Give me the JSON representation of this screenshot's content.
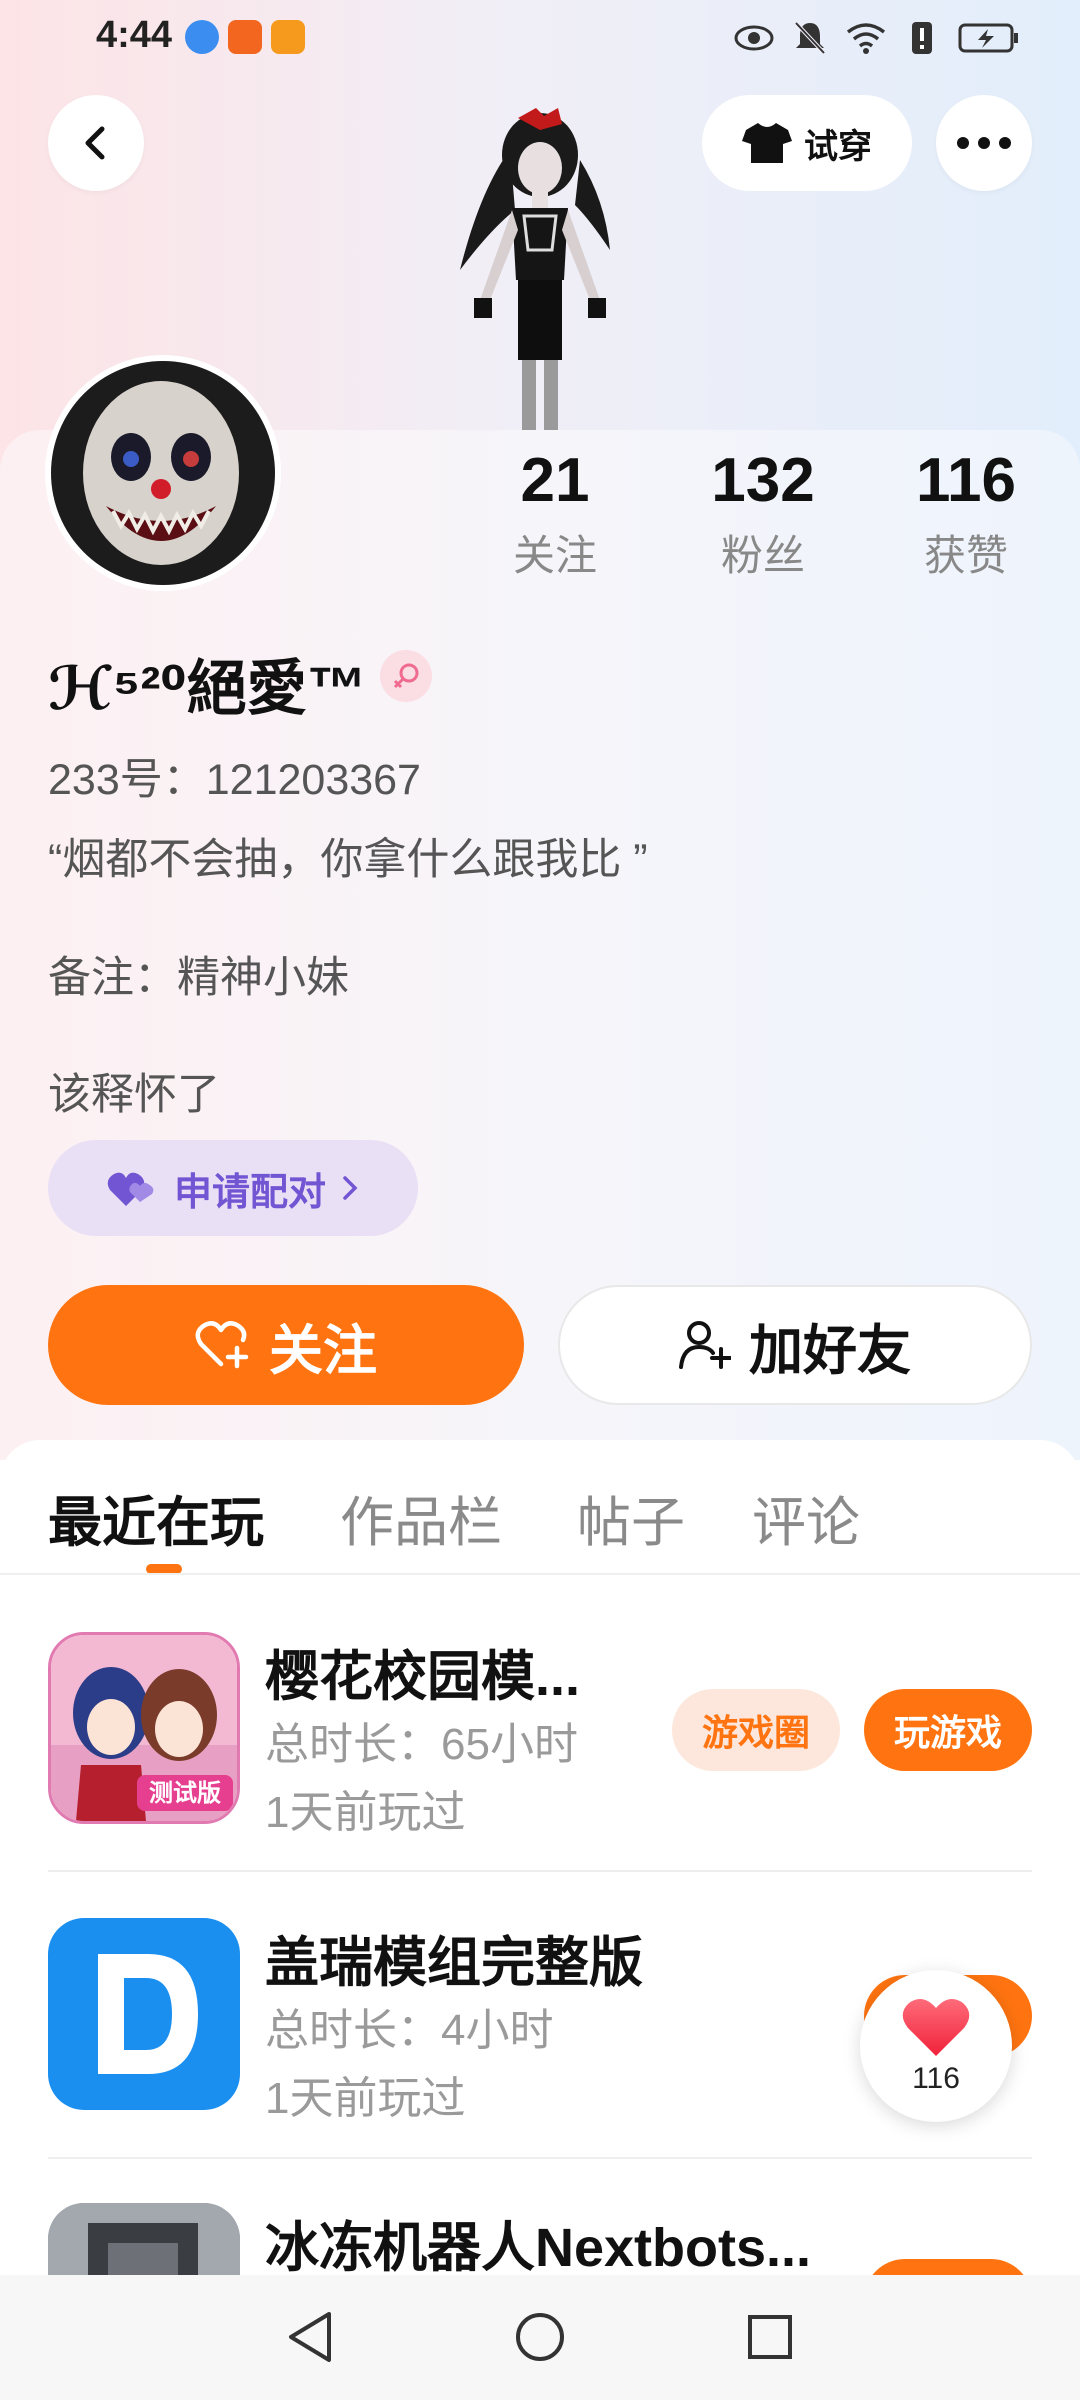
{
  "status_bar": {
    "time": "4:44",
    "icons": [
      "eye-icon",
      "bell-mute-icon",
      "wifi-icon",
      "alert-icon",
      "battery-charging-icon"
    ]
  },
  "header": {
    "try_on_label": "试穿"
  },
  "profile": {
    "stats": [
      {
        "value": "21",
        "label": "关注"
      },
      {
        "value": "132",
        "label": "粉丝"
      },
      {
        "value": "116",
        "label": "获赞"
      }
    ],
    "nickname": "ℋ⁵²⁰絕愛™",
    "gender": "female",
    "id_line": "233号：121203367",
    "signature": "“烟都不会抽，你拿什么跟我比 ”",
    "remark": "备注：精神小妹",
    "extra_line": "该释怀了"
  },
  "actions": {
    "pair_label": "申请配对",
    "follow_label": "关注",
    "add_friend_label": "加好友"
  },
  "tabs": [
    "最近在玩",
    "作品栏",
    "帖子",
    "评论"
  ],
  "games": [
    {
      "title": "樱花校园模...",
      "duration": "总时长：65小时",
      "last_played": "1天前玩过",
      "circle_label": "游戏圈",
      "play_label": "玩游戏"
    },
    {
      "title": "盖瑞模组完整版",
      "duration": "总时长：4小时",
      "last_played": "1天前玩过"
    },
    {
      "title": "冰冻机器人Nextbots..."
    }
  ],
  "like_float": {
    "count": "116"
  },
  "colors": {
    "accent": "#ff7410",
    "pair": "#7255d2"
  }
}
